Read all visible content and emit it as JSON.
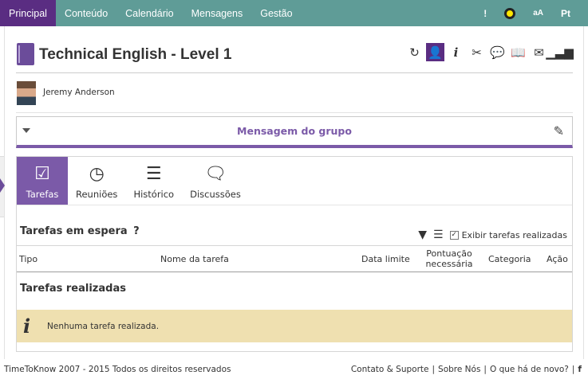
{
  "nav": {
    "items": [
      "Principal",
      "Conteúdo",
      "Calendário",
      "Mensagens",
      "Gestão"
    ],
    "right": {
      "alert": "!",
      "font_size": "aA",
      "language": "Pt"
    }
  },
  "course": {
    "title": "Technical English - Level 1"
  },
  "toolbar": {
    "icons": [
      "refresh-icon",
      "user-icon",
      "info-icon",
      "tools-icon",
      "chat-icon",
      "book-icon",
      "inbox-icon",
      "stats-icon"
    ]
  },
  "user": {
    "name": "Jeremy Anderson"
  },
  "group_message": {
    "title": "Mensagem do grupo"
  },
  "tabs": [
    {
      "label": "Tarefas",
      "icon": "checklist-icon"
    },
    {
      "label": "Reuniões",
      "icon": "clock-icon"
    },
    {
      "label": "Histórico",
      "icon": "history-icon"
    },
    {
      "label": "Discussões",
      "icon": "discussion-icon"
    }
  ],
  "tasks_pending": {
    "heading": "Tarefas em espera",
    "help": "?",
    "show_done_label": "Exibir tarefas realizadas",
    "columns": [
      "Tipo",
      "Nome da tarefa",
      "Data limite",
      "Pontuação necessária",
      "Categoria",
      "Ação"
    ]
  },
  "tasks_done": {
    "heading": "Tarefas realizadas",
    "empty_message": "Nenhuma tarefa realizada."
  },
  "footer": {
    "copyright": "TimeToKnow 2007 - 2015 Todos os direitos reservados",
    "links": [
      "Contato & Suporte",
      "Sobre Nós",
      "O que há de novo?"
    ]
  },
  "colors": {
    "nav": "#5f9c97",
    "nav_active": "#5a2d82",
    "accent": "#7b5aa8",
    "notice": "#efe0b0"
  }
}
